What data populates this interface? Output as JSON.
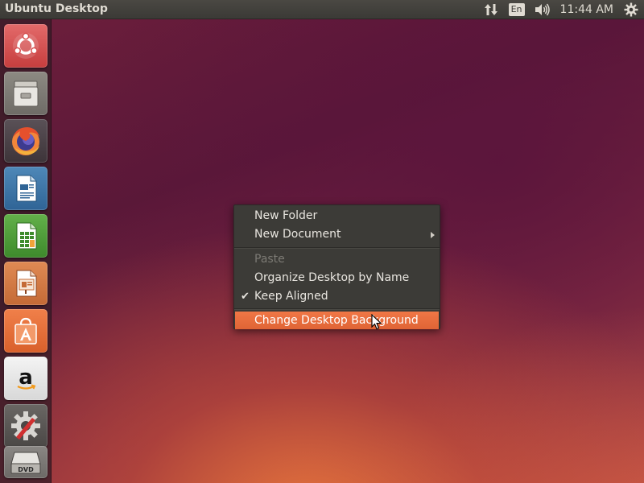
{
  "panel": {
    "title": "Ubuntu Desktop",
    "language": "En",
    "time": "11:44 AM"
  },
  "icons": {
    "network": "network-transfer-icon",
    "volume": "volume-icon",
    "settings": "gear-icon"
  },
  "launcher": {
    "items": [
      {
        "name": "ubuntu-dash-icon"
      },
      {
        "name": "files-icon"
      },
      {
        "name": "firefox-icon"
      },
      {
        "name": "libreoffice-writer-icon"
      },
      {
        "name": "libreoffice-calc-icon"
      },
      {
        "name": "libreoffice-impress-icon"
      },
      {
        "name": "ubuntu-software-icon"
      },
      {
        "name": "amazon-icon"
      },
      {
        "name": "system-settings-icon"
      },
      {
        "name": "dvd-drive-icon"
      }
    ]
  },
  "context_menu": {
    "items": [
      {
        "label": "New Folder",
        "enabled": true
      },
      {
        "label": "New Document",
        "enabled": true,
        "submenu": true
      },
      {
        "label": "Paste",
        "enabled": false
      },
      {
        "label": "Organize Desktop by Name",
        "enabled": true
      },
      {
        "label": "Keep Aligned",
        "enabled": true,
        "checked": true,
        "check_mark": "✔"
      },
      {
        "label": "Change Desktop Background",
        "enabled": true,
        "highlighted": true
      }
    ]
  },
  "colors": {
    "accent": "#e9683a",
    "panel": "#3c3b37",
    "menu_bg": "#3c3b37"
  }
}
